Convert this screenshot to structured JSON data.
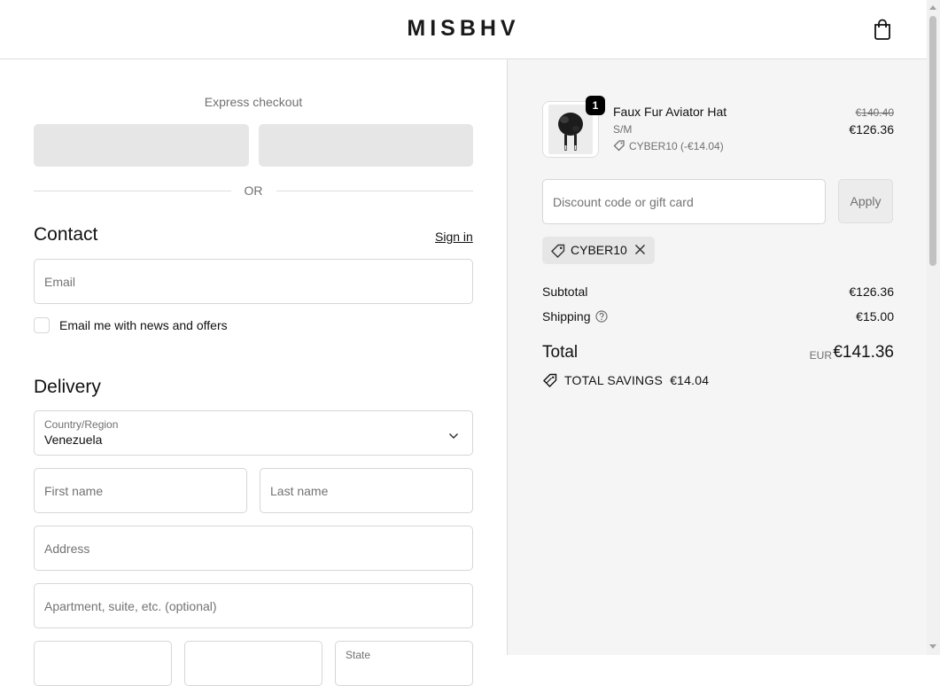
{
  "header": {
    "brand": "MISBHV",
    "cart_icon": "shopping-bag-icon"
  },
  "express": {
    "title": "Express checkout",
    "divider": "OR"
  },
  "contact": {
    "title": "Contact",
    "sign_in": "Sign in",
    "email_placeholder": "Email",
    "newsletter_label": "Email me with news and offers",
    "newsletter_checked": false
  },
  "delivery": {
    "title": "Delivery",
    "country_label": "Country/Region",
    "country_value": "Venezuela",
    "first_name_placeholder": "First name",
    "last_name_placeholder": "Last name",
    "address_placeholder": "Address",
    "apartment_placeholder": "Apartment, suite, etc. (optional)",
    "state_label": "State"
  },
  "order": {
    "item": {
      "name": "Faux Fur Aviator Hat",
      "variant": "S/M",
      "quantity": "1",
      "discount": "CYBER10 (-€14.04)",
      "price_original": "€140.40",
      "price_final": "€126.36"
    },
    "discount_placeholder": "Discount code or gift card",
    "apply_label": "Apply",
    "applied_code": "CYBER10",
    "subtotal_label": "Subtotal",
    "subtotal_value": "€126.36",
    "shipping_label": "Shipping",
    "shipping_value": "€15.00",
    "total_label": "Total",
    "currency": "EUR",
    "total_value": "€141.36",
    "savings_label": "TOTAL SAVINGS",
    "savings_value": "€14.04"
  },
  "colors": {
    "text": "#1a1a1a",
    "muted": "#707070",
    "border": "#dedede",
    "summary_bg": "#f5f5f5",
    "button_placeholder": "#e6e6e6"
  }
}
